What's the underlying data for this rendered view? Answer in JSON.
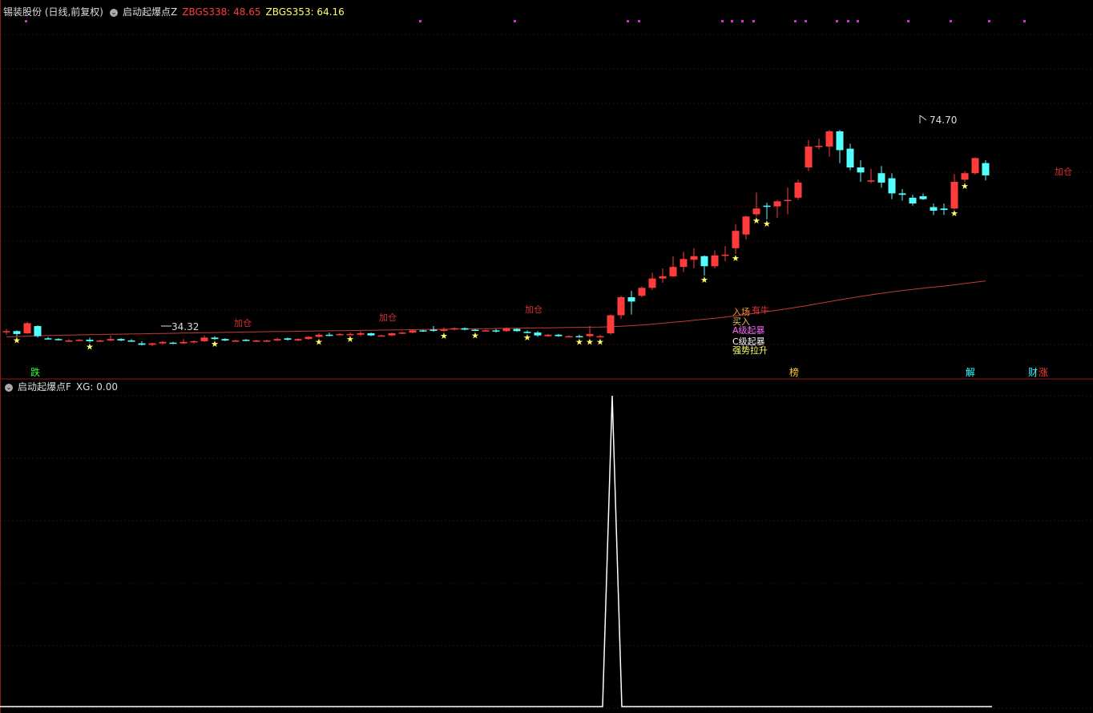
{
  "main_header": {
    "stock": "锡装股份 (日线,前复权)",
    "indicator": "启动起爆点Z",
    "zbgs338_label": "ZBGS338: 48.65",
    "zbgs353_label": "ZBGS353: 64.16"
  },
  "sub_header": {
    "indicator": "启动起爆点F",
    "xg_label": "XG: 0.00"
  },
  "annotations": {
    "high_label": "74.70",
    "low_label": "34.32",
    "jiacang": "加仓",
    "ruchang": "入场",
    "maimai": "买入",
    "youniu": "有牛",
    "a_ji": "A级起暴",
    "c_ji": "C级起暴",
    "qiangshi": "强势拉升",
    "bottom_die": "跌",
    "bottom_bang": "榜",
    "bottom_jie": "解",
    "bottom_cai": "财",
    "bottom_zhang": "涨"
  },
  "colors": {
    "up": "#ff3b3b",
    "down": "#54ffff",
    "ma": "#c23b3b",
    "star": "#ffff66",
    "purple": "#cc33cc",
    "grid": "#3a0a0a",
    "separator": "#8a1a1a",
    "xg_line": "#ffffff"
  },
  "chart_data": [
    {
      "type": "candlestick",
      "ylim": [
        30,
        80
      ],
      "candles": [
        [
          36.2,
          36.6,
          35.8,
          36.3
        ],
        [
          36.3,
          36.4,
          35.6,
          35.9
        ],
        [
          36.0,
          37.6,
          35.9,
          37.4
        ],
        [
          37.0,
          37.1,
          35.4,
          35.6
        ],
        [
          35.3,
          35.5,
          35.1,
          35.2
        ],
        [
          35.2,
          35.3,
          35.0,
          35.1
        ],
        [
          34.9,
          35.2,
          34.8,
          35.0
        ],
        [
          35.0,
          35.2,
          34.9,
          35.1
        ],
        [
          35.1,
          35.4,
          34.7,
          34.9
        ],
        [
          34.9,
          35.1,
          34.8,
          35.0
        ],
        [
          35.0,
          35.7,
          34.9,
          35.2
        ],
        [
          35.2,
          35.3,
          34.9,
          35.0
        ],
        [
          35.0,
          35.2,
          34.8,
          34.9
        ],
        [
          34.6,
          34.9,
          34.3,
          34.4
        ],
        [
          34.4,
          34.7,
          34.2,
          34.6
        ],
        [
          34.6,
          34.9,
          34.4,
          34.8
        ],
        [
          34.7,
          34.8,
          34.5,
          34.6
        ],
        [
          34.6,
          35.2,
          34.5,
          34.8
        ],
        [
          34.8,
          35.0,
          34.6,
          34.9
        ],
        [
          34.9,
          35.7,
          34.8,
          35.4
        ],
        [
          35.4,
          35.6,
          35.1,
          35.2
        ],
        [
          35.2,
          35.3,
          34.9,
          35.0
        ],
        [
          35.0,
          35.1,
          34.9,
          35.0
        ],
        [
          35.1,
          35.2,
          34.9,
          35.0
        ],
        [
          35.0,
          35.1,
          34.8,
          35.0
        ],
        [
          34.9,
          35.1,
          34.8,
          35.0
        ],
        [
          35.0,
          35.4,
          34.9,
          35.2
        ],
        [
          35.3,
          35.4,
          35.0,
          35.1
        ],
        [
          35.0,
          35.3,
          34.9,
          35.2
        ],
        [
          35.2,
          35.6,
          35.1,
          35.5
        ],
        [
          35.5,
          36.0,
          35.4,
          35.8
        ],
        [
          35.8,
          36.1,
          35.6,
          35.7
        ],
        [
          35.8,
          36.0,
          35.7,
          35.9
        ],
        [
          35.9,
          36.1,
          35.8,
          35.9
        ],
        [
          35.8,
          36.3,
          35.6,
          36.0
        ],
        [
          36.0,
          36.1,
          35.6,
          35.7
        ],
        [
          35.7,
          35.8,
          35.6,
          35.7
        ],
        [
          35.7,
          36.1,
          35.6,
          36.0
        ],
        [
          36.0,
          36.2,
          35.9,
          36.1
        ],
        [
          36.1,
          36.5,
          36.0,
          36.4
        ],
        [
          36.4,
          36.5,
          36.2,
          36.3
        ],
        [
          36.5,
          37.0,
          36.2,
          36.4
        ],
        [
          36.4,
          36.8,
          36.2,
          36.5
        ],
        [
          36.6,
          36.8,
          36.4,
          36.7
        ],
        [
          36.7,
          36.8,
          36.4,
          36.5
        ],
        [
          36.5,
          36.6,
          36.3,
          36.4
        ],
        [
          36.4,
          36.5,
          36.3,
          36.4
        ],
        [
          36.4,
          36.6,
          36.1,
          36.3
        ],
        [
          36.3,
          36.8,
          36.2,
          36.7
        ],
        [
          36.6,
          36.7,
          36.2,
          36.3
        ],
        [
          36.2,
          36.4,
          36.0,
          36.1
        ],
        [
          36.1,
          36.3,
          35.5,
          35.7
        ],
        [
          35.6,
          35.9,
          35.5,
          35.8
        ],
        [
          35.8,
          35.9,
          35.5,
          35.6
        ],
        [
          35.6,
          35.7,
          35.5,
          35.6
        ],
        [
          35.6,
          35.8,
          35.4,
          35.5
        ],
        [
          35.6,
          37.0,
          35.4,
          35.9
        ],
        [
          35.6,
          35.8,
          35.4,
          35.6
        ],
        [
          36.0,
          38.6,
          35.8,
          38.5
        ],
        [
          38.5,
          41.2,
          38.0,
          41.0
        ],
        [
          41.0,
          41.9,
          38.6,
          40.4
        ],
        [
          41.2,
          42.5,
          41.0,
          42.3
        ],
        [
          42.3,
          44.4,
          42.0,
          43.6
        ],
        [
          43.6,
          45.0,
          43.0,
          43.9
        ],
        [
          43.9,
          46.7,
          43.8,
          45.2
        ],
        [
          45.2,
          47.3,
          44.5,
          46.3
        ],
        [
          46.2,
          47.8,
          45.0,
          46.7
        ],
        [
          46.7,
          46.8,
          44.0,
          45.3
        ],
        [
          45.3,
          47.5,
          45.0,
          46.8
        ],
        [
          46.8,
          48.1,
          46.0,
          46.9
        ],
        [
          47.8,
          51.1,
          47.0,
          50.2
        ],
        [
          49.7,
          52.3,
          49.0,
          52.2
        ],
        [
          52.5,
          55.5,
          52.2,
          53.3
        ],
        [
          53.7,
          54.1,
          51.8,
          53.6
        ],
        [
          53.6,
          54.5,
          52.0,
          54.3
        ],
        [
          54.4,
          56.2,
          52.5,
          54.5
        ],
        [
          54.8,
          57.3,
          54.5,
          56.9
        ],
        [
          59.0,
          62.8,
          58.5,
          61.9
        ],
        [
          61.9,
          63.0,
          61.5,
          62.0
        ],
        [
          61.9,
          64.2,
          60.5,
          64.0
        ],
        [
          64.0,
          64.2,
          59.6,
          61.4
        ],
        [
          61.6,
          62.3,
          58.6,
          59.0
        ],
        [
          59.0,
          60.0,
          57.0,
          58.3
        ],
        [
          57.2,
          58.8,
          56.8,
          57.2
        ],
        [
          58.2,
          59.2,
          56.2,
          56.9
        ],
        [
          57.5,
          58.2,
          54.6,
          55.4
        ],
        [
          55.4,
          56.0,
          54.4,
          55.2
        ],
        [
          54.8,
          55.2,
          53.7,
          54.0
        ],
        [
          55.0,
          55.4,
          54.5,
          54.6
        ],
        [
          53.5,
          54.0,
          52.4,
          53.0
        ],
        [
          53.3,
          54.0,
          52.4,
          53.1
        ],
        [
          53.3,
          58.1,
          53.2,
          57.0
        ],
        [
          57.3,
          58.5,
          57.0,
          58.2
        ],
        [
          58.2,
          60.4,
          58.0,
          60.3
        ],
        [
          59.6,
          60.0,
          57.2,
          57.9
        ]
      ],
      "ma": [
        35.5,
        35.55,
        35.6,
        35.65,
        35.7,
        35.72,
        35.75,
        35.78,
        35.8,
        35.82,
        35.85,
        35.88,
        35.9,
        35.92,
        35.95,
        35.98,
        36.0,
        36.02,
        36.05,
        36.08,
        36.1,
        36.12,
        36.15,
        36.18,
        36.2,
        36.22,
        36.24,
        36.26,
        36.28,
        36.3,
        36.32,
        36.34,
        36.36,
        36.38,
        36.4,
        36.42,
        36.44,
        36.46,
        36.48,
        36.5,
        36.52,
        36.54,
        36.56,
        36.58,
        36.6,
        36.62,
        36.64,
        36.66,
        36.68,
        36.7,
        36.72,
        36.74,
        36.76,
        36.78,
        36.8,
        36.82,
        36.84,
        36.86,
        36.9,
        36.97,
        37.06,
        37.16,
        37.27,
        37.39,
        37.52,
        37.66,
        37.8,
        37.94,
        38.09,
        38.24,
        38.41,
        38.6,
        38.8,
        39.0,
        39.2,
        39.41,
        39.63,
        39.88,
        40.13,
        40.39,
        40.64,
        40.88,
        41.11,
        41.33,
        41.54,
        41.74,
        41.92,
        42.09,
        42.25,
        42.4,
        42.54,
        42.72,
        42.9,
        43.09,
        43.25
      ],
      "markers": [
        "加仓",
        "入场",
        "买入",
        "有牛",
        "A级起暴",
        "C级起暴",
        "强势拉升"
      ]
    },
    {
      "type": "line",
      "series": [
        {
          "name": "XG",
          "values": [
            0,
            0,
            0,
            0,
            0,
            0,
            0,
            0,
            0,
            0,
            0,
            0,
            0,
            0,
            0,
            0,
            0,
            0,
            0,
            0,
            0,
            0,
            0,
            0,
            0,
            0,
            0,
            0,
            0,
            0,
            0,
            0,
            0,
            0,
            0,
            0,
            0,
            0,
            0,
            0,
            0,
            0,
            0,
            0,
            0,
            0,
            0,
            0,
            0,
            0,
            0,
            0,
            0,
            0,
            0,
            0,
            0,
            0,
            1,
            0,
            0,
            0,
            0,
            0,
            0,
            0,
            0,
            0,
            0,
            0,
            0,
            0,
            0,
            0,
            0,
            0,
            0,
            0,
            0,
            0,
            0,
            0,
            0,
            0,
            0,
            0,
            0,
            0,
            0,
            0,
            0,
            0,
            0,
            0,
            0
          ]
        }
      ]
    }
  ]
}
